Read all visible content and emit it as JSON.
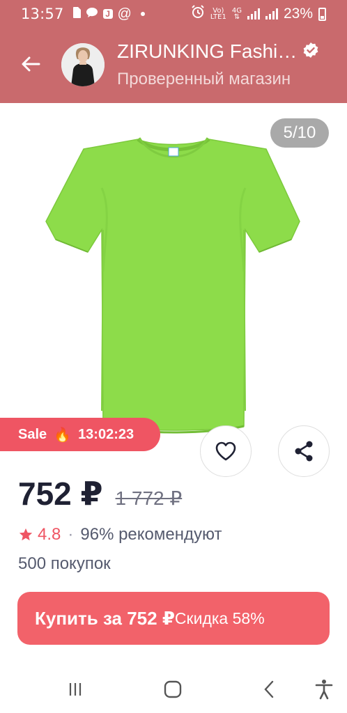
{
  "status_bar": {
    "time": "13:57",
    "network_top": "Vo)",
    "network_bottom": "LTE1",
    "data_label": "4G",
    "battery": "23%",
    "notification_letter": "J",
    "at_symbol": "@"
  },
  "header": {
    "shop_name": "ZIRUNKING Fashi…",
    "shop_subtitle": "Проверенный магазин"
  },
  "gallery": {
    "counter": "5/10",
    "product_color": "#8ddc4a"
  },
  "sale": {
    "label": "Sale",
    "emoji": "🔥",
    "timer": "13:02:23"
  },
  "price": {
    "current": "752 ₽",
    "old": "1 772 ₽"
  },
  "rating": {
    "value": "4.8",
    "separator": "·",
    "recommend": "96% рекомендуют",
    "purchases": "500 покупок"
  },
  "buy_button": {
    "label": "Купить за 752 ₽",
    "discount": "Скидка 58%"
  },
  "colors": {
    "header_bg": "#c96a6d",
    "accent": "#ef5563",
    "buy_bg": "#f2626a"
  },
  "icons": [
    "back-arrow-icon",
    "verified-icon",
    "heart-icon",
    "share-icon",
    "star-icon",
    "fire-icon",
    "recents-icon",
    "home-icon",
    "back-icon",
    "accessibility-icon"
  ]
}
